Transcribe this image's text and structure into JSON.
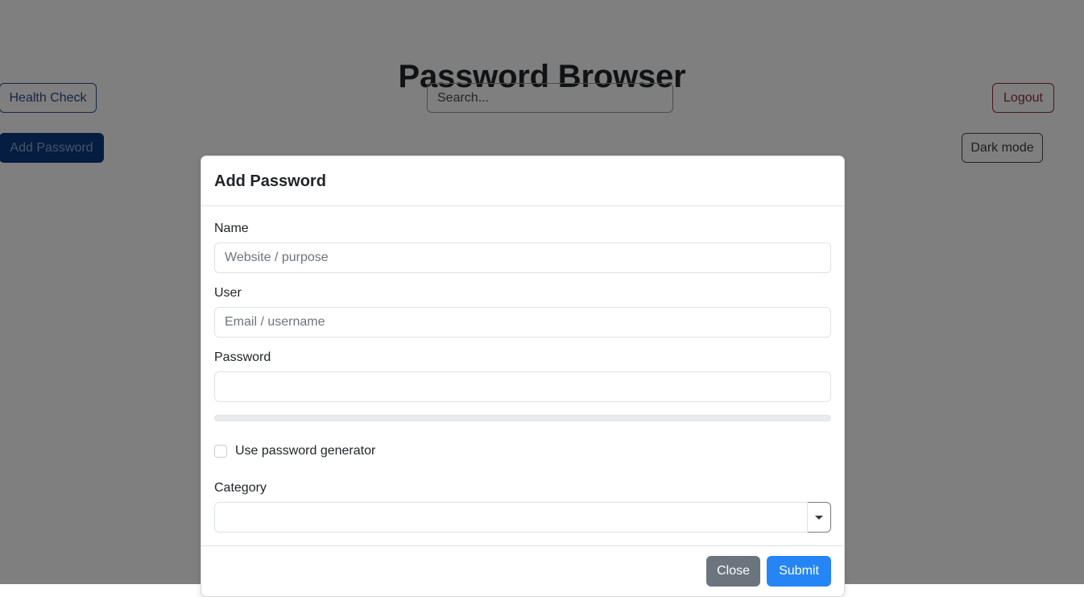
{
  "app": {
    "title": "Password Browser"
  },
  "toolbar": {
    "health_check_label": "Health Check",
    "add_password_label": "Add Password",
    "logout_label": "Logout",
    "dark_mode_label": "Dark mode"
  },
  "search": {
    "value": "",
    "placeholder": "Search..."
  },
  "modal": {
    "title": "Add Password",
    "fields": {
      "name": {
        "label": "Name",
        "value": "",
        "placeholder": "Website / purpose"
      },
      "user": {
        "label": "User",
        "value": "",
        "placeholder": "Email / username"
      },
      "password": {
        "label": "Password",
        "value": "",
        "placeholder": ""
      },
      "category": {
        "label": "Category",
        "value": "",
        "placeholder": ""
      }
    },
    "strength": {
      "percent": 0
    },
    "generator": {
      "label": "Use password generator",
      "checked": false
    },
    "footer": {
      "close_label": "Close",
      "submit_label": "Submit"
    }
  },
  "colors": {
    "primary_dark": "#0b3b82",
    "submit_blue": "#2585f5",
    "secondary_gray": "#6c757d",
    "danger_red": "#8a3136",
    "backdrop": "#808080"
  }
}
